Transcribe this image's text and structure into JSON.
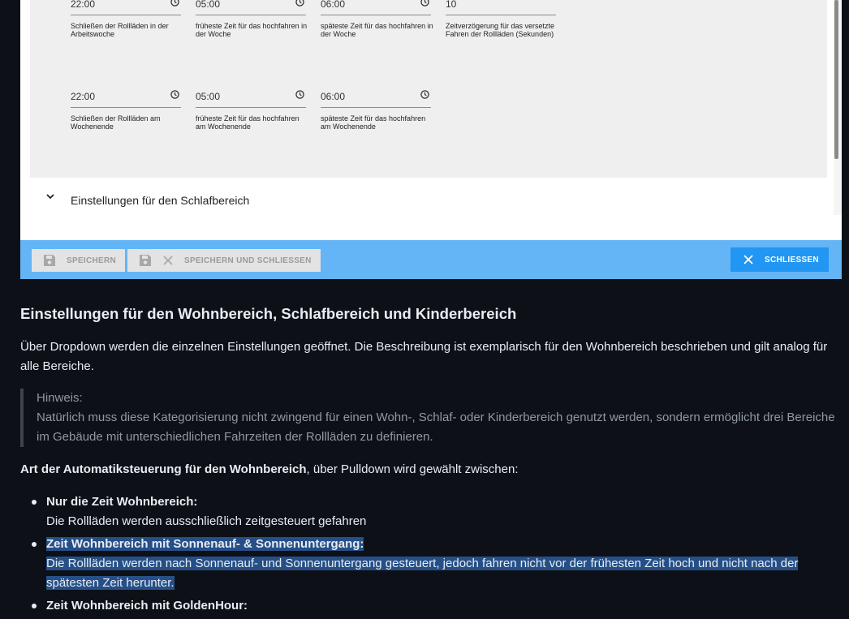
{
  "settings_panel": {
    "workweek_row": [
      {
        "value": "22:00",
        "description": "Schließen der Rollläden in der Arbeitswoche",
        "has_clock": true
      },
      {
        "value": "05:00",
        "description": "früheste Zeit für das hochfahren in der Woche",
        "has_clock": true
      },
      {
        "value": "06:00",
        "description": "späteste Zeit für das hochfahren in der Woche",
        "has_clock": true
      },
      {
        "value": "10",
        "description": "Zeitverzögerung für das versetzte Fahren der Rollläden (Sekunden)",
        "has_clock": false
      }
    ],
    "weekend_row": [
      {
        "value": "22:00",
        "description": "Schließen der Rollläden am Wochenende",
        "has_clock": true
      },
      {
        "value": "05:00",
        "description": "früheste Zeit für das hochfahren am Wochenende",
        "has_clock": true
      },
      {
        "value": "06:00",
        "description": "späteste Zeit für das hochfahren am Wochenende",
        "has_clock": true
      }
    ],
    "accordion_label": "Einstellungen für den Schlafbereich",
    "toolbar": {
      "save_label": "SPEICHERN",
      "save_close_label": "SPEICHERN UND SCHLIESSEN",
      "close_label": "SCHLIESSEN"
    }
  },
  "article": {
    "title": "Einstellungen für den Wohnbereich, Schlafbereich und Kinderbereich",
    "intro": "Über Dropdown werden die einzelnen Einstellungen geöffnet. Die Beschreibung ist exemplarisch für den Wohnbereich beschrieben und gilt analog für alle Bereiche.",
    "note_heading": "Hinweis:",
    "note_text": "Natürlich muss diese Kategorisierung nicht zwingend für einen Wohn-, Schlaf- oder Kinderbereich genutzt werden, sondern ermöglicht drei Bereiche im Gebäude mit unterschiedlichen Fahrzeiten der Rollläden zu definieren.",
    "choice_bold": "Art der Automatiksteuerung für den Wohnbereich",
    "choice_rest": ", über Pulldown wird gewählt zwischen:",
    "options": [
      {
        "title": "Nur die Zeit Wohnbereich:",
        "text": "Die Rollläden werden ausschließlich zeitgesteuert gefahren"
      },
      {
        "title": "Zeit Wohnbereich mit Sonnenauf- & Sonnenuntergang:",
        "text": "Die Rollläden werden nach Sonnenauf- und Sonnenuntergang gesteuert, jedoch fahren nicht vor der frühesten Zeit hoch und nicht nach der spätesten Zeit herunter."
      },
      {
        "title": "Zeit Wohnbereich mit GoldenHour:",
        "text": ""
      }
    ]
  }
}
